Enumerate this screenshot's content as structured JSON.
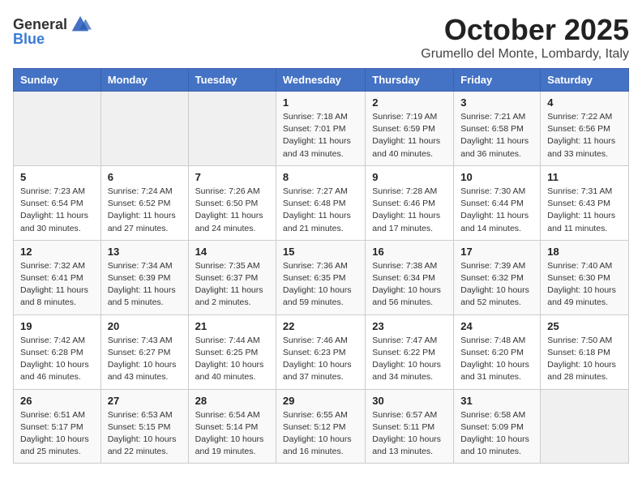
{
  "logo": {
    "general": "General",
    "blue": "Blue"
  },
  "title": "October 2025",
  "location": "Grumello del Monte, Lombardy, Italy",
  "days_of_week": [
    "Sunday",
    "Monday",
    "Tuesday",
    "Wednesday",
    "Thursday",
    "Friday",
    "Saturday"
  ],
  "weeks": [
    [
      {
        "day": "",
        "info": ""
      },
      {
        "day": "",
        "info": ""
      },
      {
        "day": "",
        "info": ""
      },
      {
        "day": "1",
        "info": "Sunrise: 7:18 AM\nSunset: 7:01 PM\nDaylight: 11 hours and 43 minutes."
      },
      {
        "day": "2",
        "info": "Sunrise: 7:19 AM\nSunset: 6:59 PM\nDaylight: 11 hours and 40 minutes."
      },
      {
        "day": "3",
        "info": "Sunrise: 7:21 AM\nSunset: 6:58 PM\nDaylight: 11 hours and 36 minutes."
      },
      {
        "day": "4",
        "info": "Sunrise: 7:22 AM\nSunset: 6:56 PM\nDaylight: 11 hours and 33 minutes."
      }
    ],
    [
      {
        "day": "5",
        "info": "Sunrise: 7:23 AM\nSunset: 6:54 PM\nDaylight: 11 hours and 30 minutes."
      },
      {
        "day": "6",
        "info": "Sunrise: 7:24 AM\nSunset: 6:52 PM\nDaylight: 11 hours and 27 minutes."
      },
      {
        "day": "7",
        "info": "Sunrise: 7:26 AM\nSunset: 6:50 PM\nDaylight: 11 hours and 24 minutes."
      },
      {
        "day": "8",
        "info": "Sunrise: 7:27 AM\nSunset: 6:48 PM\nDaylight: 11 hours and 21 minutes."
      },
      {
        "day": "9",
        "info": "Sunrise: 7:28 AM\nSunset: 6:46 PM\nDaylight: 11 hours and 17 minutes."
      },
      {
        "day": "10",
        "info": "Sunrise: 7:30 AM\nSunset: 6:44 PM\nDaylight: 11 hours and 14 minutes."
      },
      {
        "day": "11",
        "info": "Sunrise: 7:31 AM\nSunset: 6:43 PM\nDaylight: 11 hours and 11 minutes."
      }
    ],
    [
      {
        "day": "12",
        "info": "Sunrise: 7:32 AM\nSunset: 6:41 PM\nDaylight: 11 hours and 8 minutes."
      },
      {
        "day": "13",
        "info": "Sunrise: 7:34 AM\nSunset: 6:39 PM\nDaylight: 11 hours and 5 minutes."
      },
      {
        "day": "14",
        "info": "Sunrise: 7:35 AM\nSunset: 6:37 PM\nDaylight: 11 hours and 2 minutes."
      },
      {
        "day": "15",
        "info": "Sunrise: 7:36 AM\nSunset: 6:35 PM\nDaylight: 10 hours and 59 minutes."
      },
      {
        "day": "16",
        "info": "Sunrise: 7:38 AM\nSunset: 6:34 PM\nDaylight: 10 hours and 56 minutes."
      },
      {
        "day": "17",
        "info": "Sunrise: 7:39 AM\nSunset: 6:32 PM\nDaylight: 10 hours and 52 minutes."
      },
      {
        "day": "18",
        "info": "Sunrise: 7:40 AM\nSunset: 6:30 PM\nDaylight: 10 hours and 49 minutes."
      }
    ],
    [
      {
        "day": "19",
        "info": "Sunrise: 7:42 AM\nSunset: 6:28 PM\nDaylight: 10 hours and 46 minutes."
      },
      {
        "day": "20",
        "info": "Sunrise: 7:43 AM\nSunset: 6:27 PM\nDaylight: 10 hours and 43 minutes."
      },
      {
        "day": "21",
        "info": "Sunrise: 7:44 AM\nSunset: 6:25 PM\nDaylight: 10 hours and 40 minutes."
      },
      {
        "day": "22",
        "info": "Sunrise: 7:46 AM\nSunset: 6:23 PM\nDaylight: 10 hours and 37 minutes."
      },
      {
        "day": "23",
        "info": "Sunrise: 7:47 AM\nSunset: 6:22 PM\nDaylight: 10 hours and 34 minutes."
      },
      {
        "day": "24",
        "info": "Sunrise: 7:48 AM\nSunset: 6:20 PM\nDaylight: 10 hours and 31 minutes."
      },
      {
        "day": "25",
        "info": "Sunrise: 7:50 AM\nSunset: 6:18 PM\nDaylight: 10 hours and 28 minutes."
      }
    ],
    [
      {
        "day": "26",
        "info": "Sunrise: 6:51 AM\nSunset: 5:17 PM\nDaylight: 10 hours and 25 minutes."
      },
      {
        "day": "27",
        "info": "Sunrise: 6:53 AM\nSunset: 5:15 PM\nDaylight: 10 hours and 22 minutes."
      },
      {
        "day": "28",
        "info": "Sunrise: 6:54 AM\nSunset: 5:14 PM\nDaylight: 10 hours and 19 minutes."
      },
      {
        "day": "29",
        "info": "Sunrise: 6:55 AM\nSunset: 5:12 PM\nDaylight: 10 hours and 16 minutes."
      },
      {
        "day": "30",
        "info": "Sunrise: 6:57 AM\nSunset: 5:11 PM\nDaylight: 10 hours and 13 minutes."
      },
      {
        "day": "31",
        "info": "Sunrise: 6:58 AM\nSunset: 5:09 PM\nDaylight: 10 hours and 10 minutes."
      },
      {
        "day": "",
        "info": ""
      }
    ]
  ]
}
